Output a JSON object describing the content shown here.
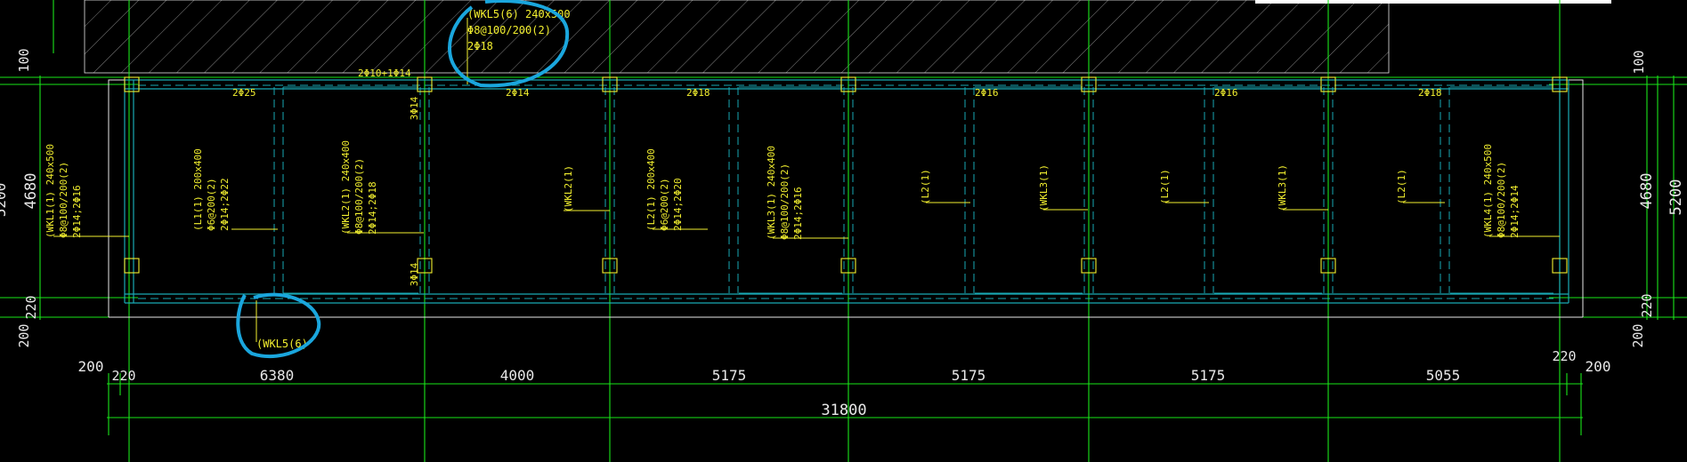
{
  "colors": {
    "background": "#000000",
    "grid": "#19e619",
    "beam": "#19a9b5",
    "annotation": "#f2ef2f",
    "dimension": "#e8e8e8",
    "highlight": "#1aa6dd"
  },
  "left_dims": {
    "top": "100",
    "main": "4680",
    "bottom_short": "220",
    "bottom": "200",
    "cut": "5200"
  },
  "right_dims": {
    "top": "100",
    "main": "4680",
    "bottom_short": "220",
    "bottom": "200",
    "total": "5200"
  },
  "top_callout": {
    "line1": "(WKL5(6) 240x500",
    "line2": "Φ8@100/200(2)",
    "line3": "2Φ18"
  },
  "bottom_callout": {
    "label": "(WKL5(6)"
  },
  "top_edge_label": "2Φ10+1Φ14",
  "top_rebar": [
    "2Φ25",
    "2Φ14",
    "2Φ18",
    "2Φ16",
    "2Φ16",
    "2Φ18"
  ],
  "side_rebar": [
    "3Φ14",
    "3Φ14"
  ],
  "beams": [
    {
      "l1": "(WKL1(1) 240x500",
      "l2": "Φ8@100/200(2)",
      "l3": "2Φ14;2Φ16"
    },
    {
      "l1": "(L1(1) 200x400",
      "l2": "Φ6@200(2)",
      "l3": "2Φ14;2Φ22"
    },
    {
      "l1": "(WKL2(1) 240x400",
      "l2": "Φ8@100/200(2)",
      "l3": "2Φ14;2Φ18"
    },
    {
      "l1": "(WKL2(1)"
    },
    {
      "l1": "(L2(1) 200x400",
      "l2": "Φ6@200(2)",
      "l3": "2Φ14;2Φ20"
    },
    {
      "l1": "(WKL3(1) 240x400",
      "l2": "Φ8@100/200(2)",
      "l3": "2Φ14;2Φ16"
    },
    {
      "l1": "(L2(1)"
    },
    {
      "l1": "(WKL3(1)"
    },
    {
      "l1": "(L2(1)"
    },
    {
      "l1": "(WKL3(1)"
    },
    {
      "l1": "(L2(1)"
    },
    {
      "l1": "(WKL4(1) 240x500",
      "l2": "Φ8@100/200(2)",
      "l3": "2Φ14;2Φ14"
    }
  ],
  "bottom_dims": {
    "left_outer": "200",
    "left_inner": "220",
    "spans": [
      "6380",
      "4000",
      "5175",
      "5175",
      "5175",
      "5055"
    ],
    "right_inner": "220",
    "right_outer": "200",
    "total": "31800"
  }
}
